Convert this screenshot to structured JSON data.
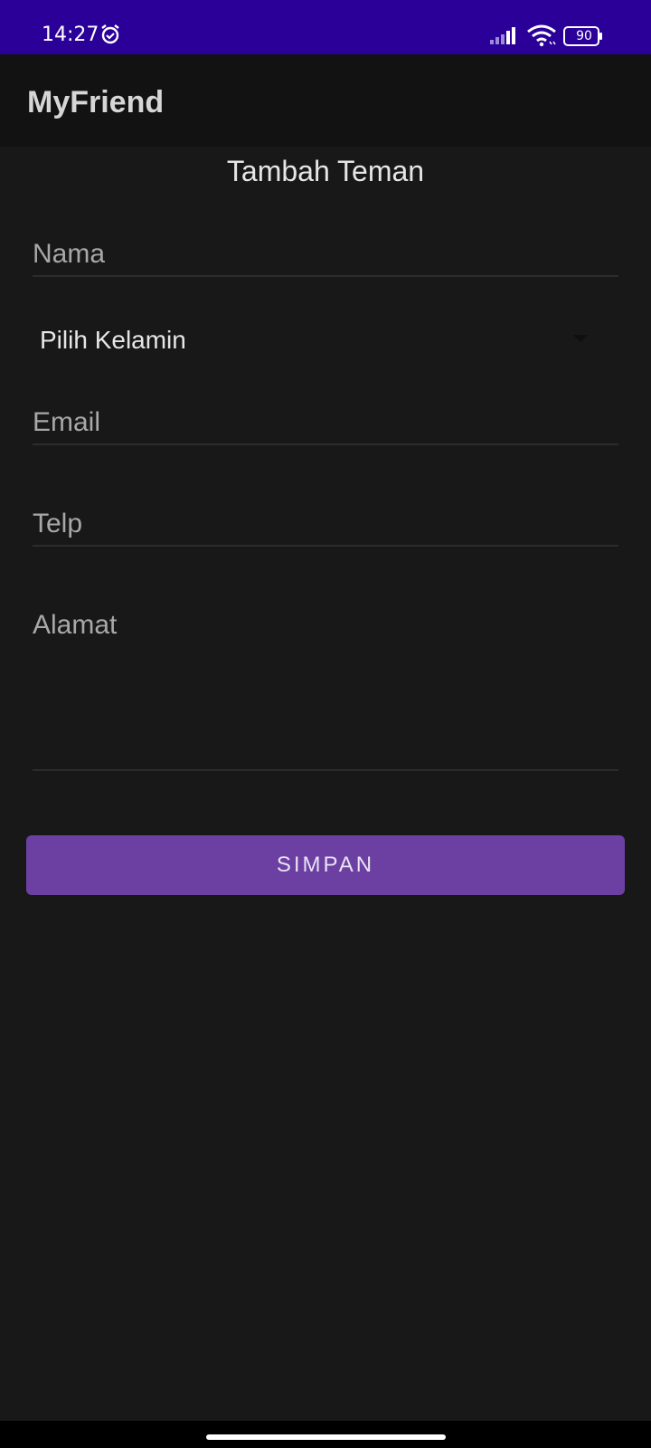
{
  "status_bar": {
    "time": "14:27",
    "battery_level": "90",
    "icons": [
      "alarm-icon",
      "signal-icon",
      "wifi-icon",
      "battery-icon"
    ],
    "background_color": "#2a0099"
  },
  "app_bar": {
    "title": "MyFriend"
  },
  "form": {
    "heading": "Tambah Teman",
    "fields": {
      "nama": {
        "placeholder": "Nama",
        "value": ""
      },
      "email": {
        "placeholder": "Email",
        "value": ""
      },
      "telp": {
        "placeholder": "Telp",
        "value": ""
      },
      "alamat": {
        "placeholder": "Alamat",
        "value": ""
      }
    },
    "gender_select": {
      "selected": "Pilih Kelamin",
      "icon": "chevron-down-icon"
    },
    "save_label": "SIMPAN"
  },
  "colors": {
    "background": "#181818",
    "app_bar": "#121212",
    "accent": "#6c40a2"
  }
}
